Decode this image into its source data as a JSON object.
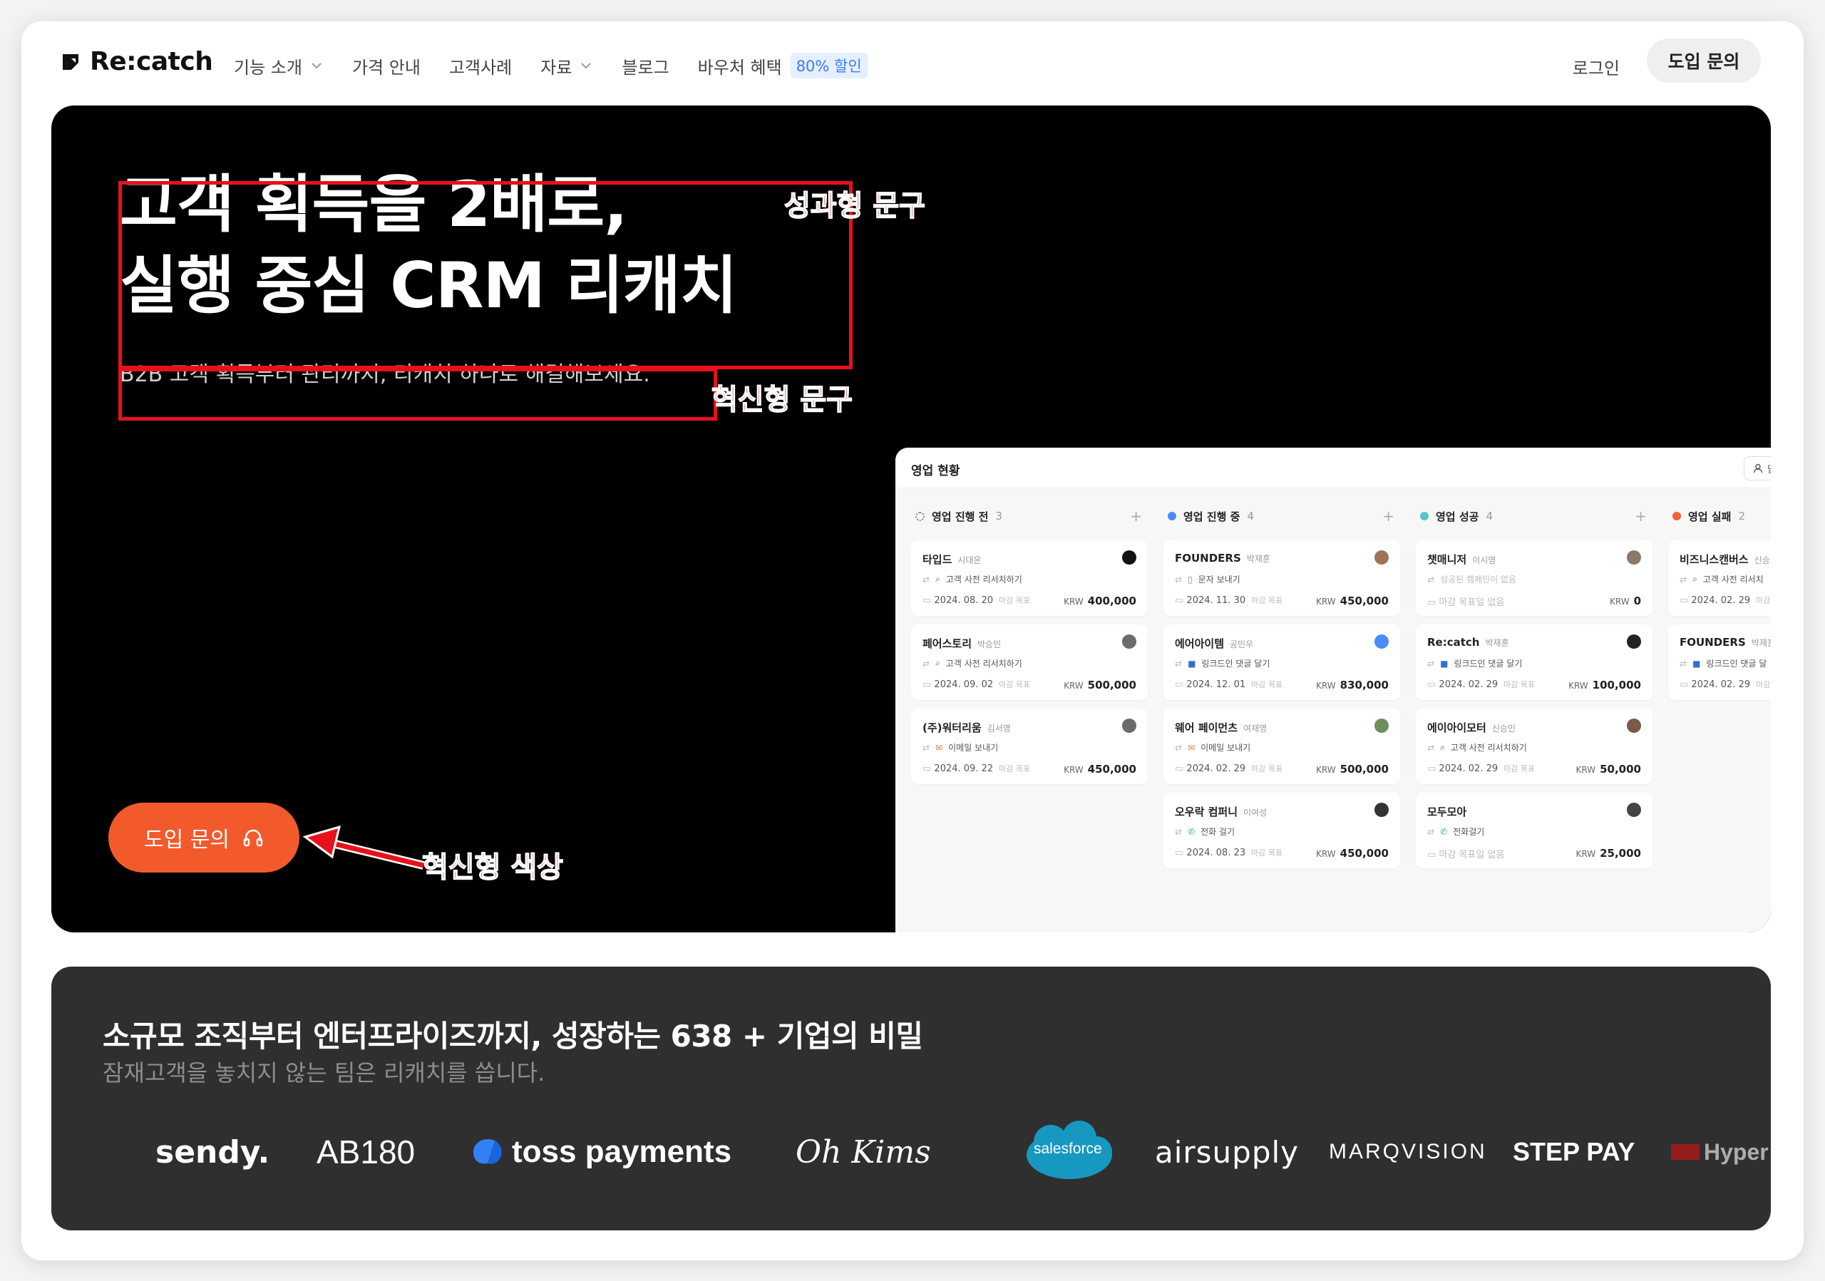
{
  "nav": {
    "brand": "Re:catch",
    "items": [
      {
        "label": "기능 소개",
        "dropdown": true
      },
      {
        "label": "가격 안내",
        "dropdown": false
      },
      {
        "label": "고객사례",
        "dropdown": false
      },
      {
        "label": "자료",
        "dropdown": true
      },
      {
        "label": "블로그",
        "dropdown": false
      },
      {
        "label": "바우처 혜택",
        "dropdown": false
      }
    ],
    "voucher_badge": "80% 할인",
    "login": "로그인",
    "cta": "도입 문의"
  },
  "hero": {
    "title_line1": "고객 획득을 2배로,",
    "title_line2": "실행 중심 CRM 리캐치",
    "subtitle": "B2B 고객 획득부터 관리까지, 리캐치 하나로 해결해보세요.",
    "cta": "도입 문의",
    "annotations": {
      "title_label": "성과형 문구",
      "subtitle_label": "혁신형 문구",
      "cta_label": "혁신형 색상"
    },
    "annotation_color": "#e8111b",
    "cta_color": "#f25a2c"
  },
  "dashboard": {
    "title": "영업 현황",
    "button_label": "담당",
    "columns": [
      {
        "name": "영업 진행 전",
        "count": "3",
        "dot": "none",
        "cards": [
          {
            "company": "타입드",
            "owner": "시대운",
            "task": "고객 사전 리서치하기",
            "date": "2024. 08. 20",
            "note": "마감 목표",
            "currency": "KRW",
            "amount": "400,000"
          },
          {
            "company": "페어스토리",
            "owner": "박승민",
            "task": "고객 사전 리서치하기",
            "date": "2024. 09. 02",
            "note": "마감 목표",
            "currency": "KRW",
            "amount": "500,000"
          },
          {
            "company": "(주)워터리움",
            "owner": "김서영",
            "task": "이메일 보내기",
            "date": "2024. 09. 22",
            "note": "마감 목표",
            "currency": "KRW",
            "amount": "450,000"
          }
        ]
      },
      {
        "name": "영업 진행 중",
        "count": "4",
        "dot": "#4a8cf7",
        "cards": [
          {
            "company": "FOUNDERS",
            "owner": "박재훈",
            "task": "문자 보내기",
            "date": "2024. 11. 30",
            "note": "마감 목표",
            "currency": "KRW",
            "amount": "450,000"
          },
          {
            "company": "에어아이템",
            "owner": "공민우",
            "task": "링크드인 댓글 달기",
            "date": "2024. 12. 01",
            "note": "마감 목표",
            "currency": "KRW",
            "amount": "830,000"
          },
          {
            "company": "웨어 페이먼츠",
            "owner": "여재영",
            "task": "이메일 보내기",
            "date": "2024. 02. 29",
            "note": "마감 목표",
            "currency": "KRW",
            "amount": "500,000"
          },
          {
            "company": "오우락 컴퍼니",
            "owner": "이여성",
            "task": "전화 걸기",
            "date": "2024. 08. 23",
            "note": "마감 목표",
            "currency": "KRW",
            "amount": "450,000"
          }
        ]
      },
      {
        "name": "영업 성공",
        "count": "4",
        "dot": "#52c7c7",
        "cards": [
          {
            "company": "챗매니저",
            "owner": "이시영",
            "task": "성공된 캠페인이 없음",
            "date": "마감 목표일 없음",
            "note": "",
            "currency": "KRW",
            "amount": "0"
          },
          {
            "company": "Re:catch",
            "owner": "박재훈",
            "task": "링크드인 댓글 달기",
            "date": "2024. 02. 29",
            "note": "마감 목표",
            "currency": "KRW",
            "amount": "100,000"
          },
          {
            "company": "에이아이모터",
            "owner": "신승민",
            "task": "고객 사전 리서치하기",
            "date": "2024. 02. 29",
            "note": "마감 목표",
            "currency": "KRW",
            "amount": "50,000"
          },
          {
            "company": "모두모아",
            "owner": "",
            "task": "전화걸기",
            "date": "마감 목표일 없음",
            "note": "",
            "currency": "KRW",
            "amount": "25,000"
          }
        ]
      },
      {
        "name": "영업 실패",
        "count": "2",
        "dot": "#f0643a",
        "cards": [
          {
            "company": "비즈니스캔버스",
            "owner": "신승민",
            "task": "고객 사전 리서치",
            "date": "2024. 02. 29",
            "note": "마감",
            "currency": "",
            "amount": ""
          },
          {
            "company": "FOUNDERS",
            "owner": "박재훈",
            "task": "링크드인 댓글 달",
            "date": "2024. 02. 29",
            "note": "마감",
            "currency": "",
            "amount": ""
          }
        ]
      }
    ]
  },
  "customers": {
    "title": "소규모 조직부터 엔터프라이즈까지, 성장하는 638 + 기업의 비밀",
    "subtitle": "잠재고객을 놓치지 않는 팀은 리캐치를 씁니다.",
    "logos": [
      "sendy.",
      "AB180",
      "toss payments",
      "Oh Kims",
      "salesforce",
      "airsupply",
      "MARQVISION",
      "STEP PAY",
      "Hyper"
    ]
  }
}
